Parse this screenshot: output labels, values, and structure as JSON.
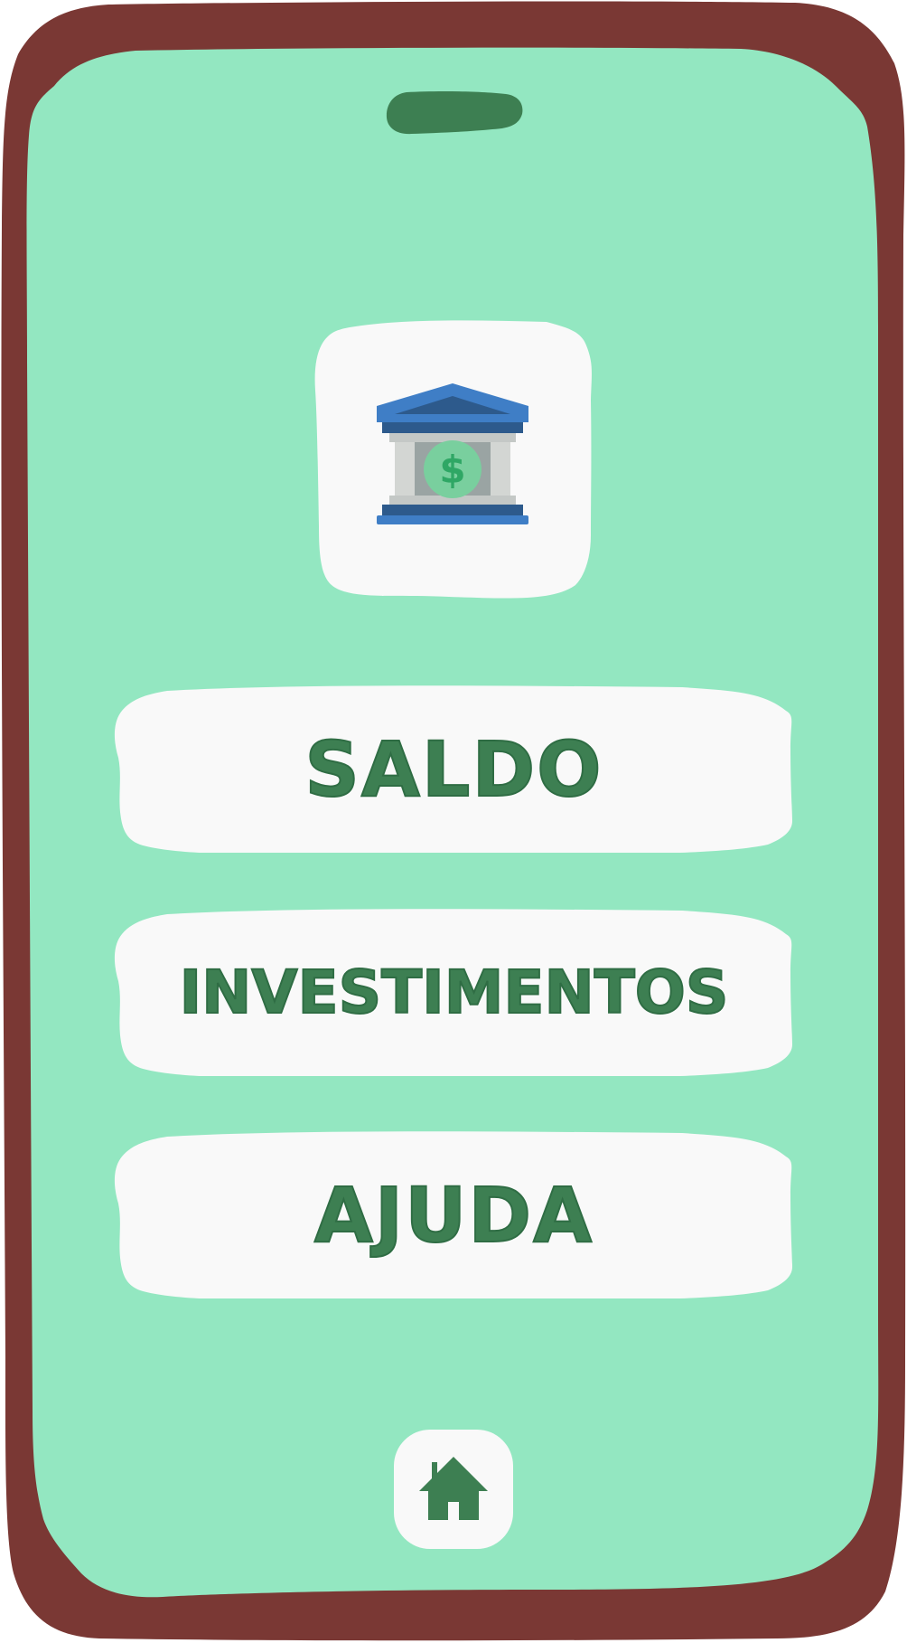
{
  "colors": {
    "frame": "#7a3834",
    "screen": "#93e7c1",
    "card": "#f9f9f9",
    "accent_green": "#3d7f52",
    "bank_blue": "#3f7ec6",
    "bank_dark_blue": "#2d5a8c"
  },
  "header": {
    "notch_icon": "speaker-notch",
    "logo_icon": "bank-dollar-icon"
  },
  "menu": {
    "items": [
      {
        "label": "SALDO",
        "icon": "none"
      },
      {
        "label": "INVESTIMENTOS",
        "icon": "none"
      },
      {
        "label": "AJUDA",
        "icon": "none"
      }
    ]
  },
  "footer": {
    "home_icon": "home-icon"
  }
}
